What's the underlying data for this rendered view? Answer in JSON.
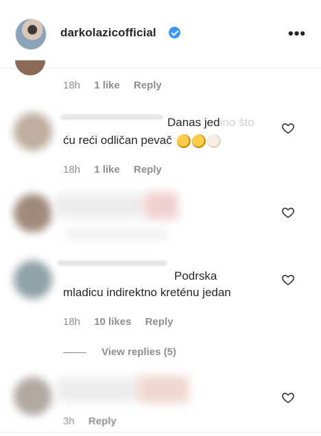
{
  "header": {
    "username": "darkolazicofficial",
    "verified": true,
    "more_label": "•••"
  },
  "comments": [
    {
      "time": "18h",
      "likes": "1 like",
      "reply": "Reply"
    },
    {
      "text_line1": "Danas jed",
      "text_line1_faded": "ino što",
      "text_line2": "ću reći odličan pevač",
      "time": "18h",
      "likes": "1 like",
      "reply": "Reply"
    },
    {
      "text_line1": "",
      "time": "",
      "likes": "",
      "reply": ""
    },
    {
      "text_line1": "Podrska",
      "text_line2": "mladicu indirektno kreténu jedan",
      "time": "18h",
      "likes": "10 likes",
      "reply": "Reply",
      "view_replies": "View replies (5)"
    },
    {
      "time": "3h",
      "reply": "Reply"
    }
  ],
  "colors": {
    "accent": "#3897f0",
    "meta": "#8e8e8e",
    "text": "#262626"
  },
  "icons": {
    "verified": "verified-badge-icon",
    "like": "heart-icon",
    "more": "more-options-icon"
  }
}
